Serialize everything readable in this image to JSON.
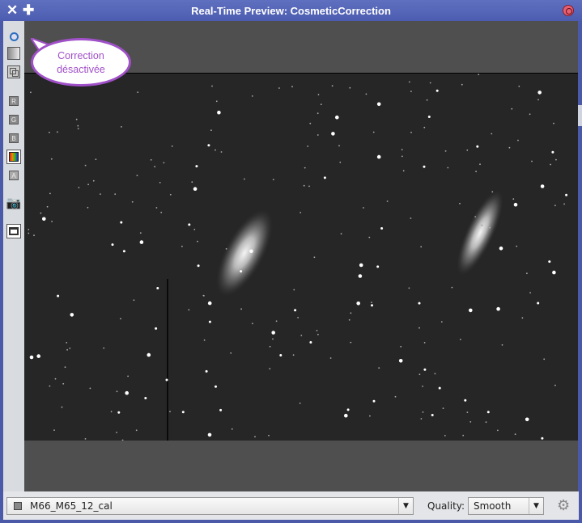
{
  "window": {
    "title": "Real-Time Preview: CosmeticCorrection"
  },
  "toolbar": {
    "items": [
      "R",
      "G",
      "B",
      "A"
    ]
  },
  "bubble": {
    "line1": "Correction",
    "line2": "désactivée"
  },
  "bottom": {
    "view_select": "M66_M65_12_cal",
    "quality_label": "Quality:",
    "quality_value": "Smooth"
  },
  "colors": {
    "titlebar": "#5565b5",
    "bubble": "#a050c8",
    "canvas": "#4f4f4f"
  }
}
